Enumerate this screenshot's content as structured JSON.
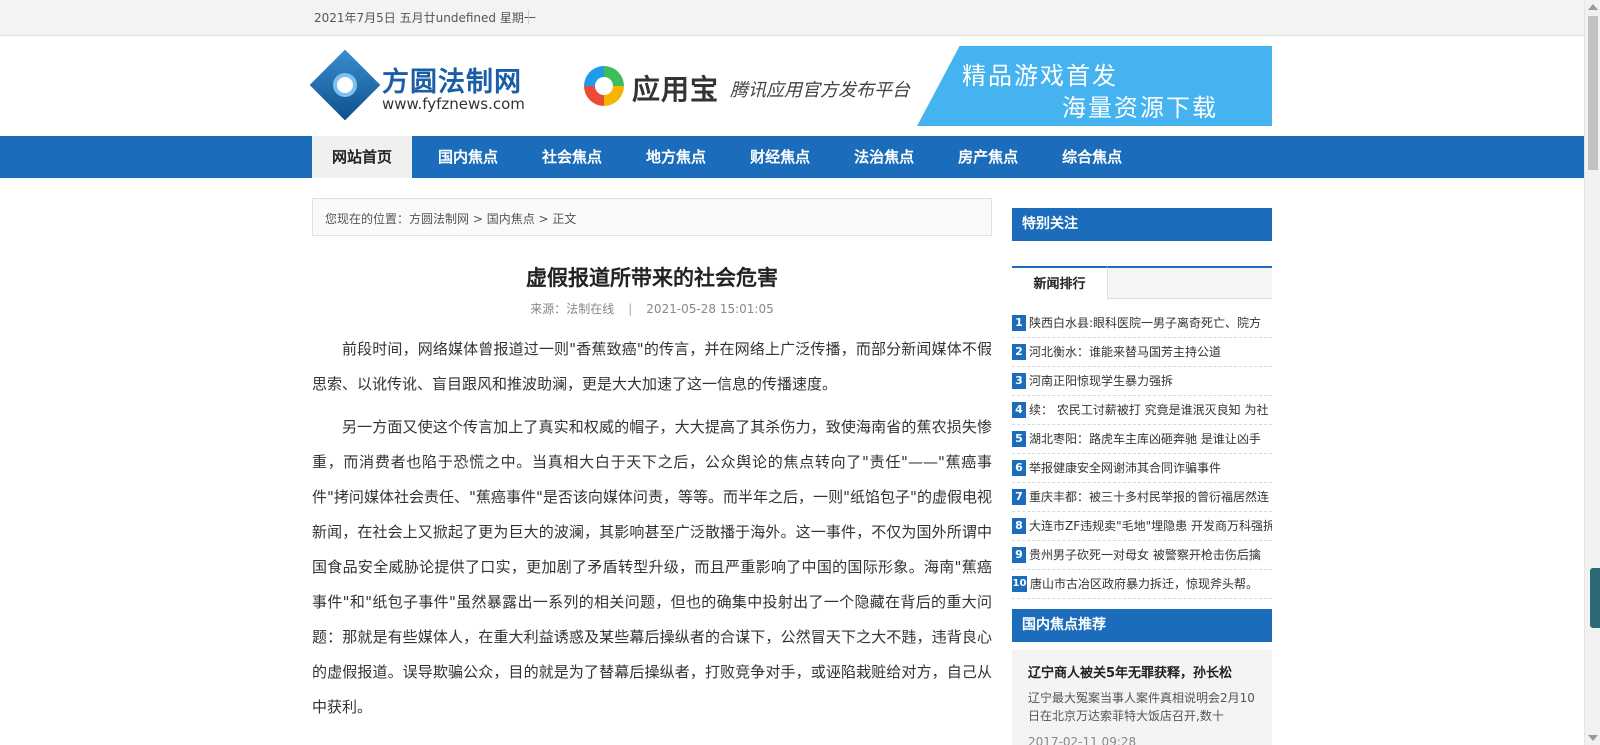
{
  "topbar": {
    "date": "2021年7月5日 五月廿undefined 星期一"
  },
  "logo": {
    "name_cn": "方圆法制网",
    "url_text": "www.fyfznews.com"
  },
  "banner": {
    "brand": "应用宝",
    "tagline": "腾讯应用官方发布平台",
    "slogan_line1": "精品游戏首发",
    "slogan_line2": "海量资源下载"
  },
  "nav": {
    "items": [
      {
        "label": "网站首页",
        "active": true
      },
      {
        "label": "国内焦点"
      },
      {
        "label": "社会焦点"
      },
      {
        "label": "地方焦点"
      },
      {
        "label": "财经焦点"
      },
      {
        "label": "法治焦点"
      },
      {
        "label": "房产焦点"
      },
      {
        "label": "综合焦点"
      }
    ]
  },
  "breadcrumb": {
    "prefix": "您现在的位置：",
    "home": "方圆法制网",
    "sep": " > ",
    "section": "国内焦点",
    "current": "正文"
  },
  "article": {
    "title": "虚假报道所带来的社会危害",
    "source": "来源：法制在线",
    "divider": "|",
    "datetime": "2021-05-28 15:01:05",
    "paragraphs": [
      "前段时间，网络媒体曾报道过一则\"香蕉致癌\"的传言，并在网络上广泛传播，而部分新闻媒体不假思索、以讹传讹、盲目跟风和推波助澜，更是大大加速了这一信息的传播速度。",
      "另一方面又使这个传言加上了真实和权威的帽子，大大提高了其杀伤力，致使海南省的蕉农损失惨重，而消费者也陷于恐慌之中。当真相大白于天下之后，公众舆论的焦点转向了\"责任\"——\"蕉癌事件\"拷问媒体社会责任、\"蕉癌事件\"是否该向媒体问责，等等。而半年之后，一则\"纸馅包子\"的虚假电视新闻，在社会上又掀起了更为巨大的波澜，其影响甚至广泛散播于海外。这一事件，不仅为国外所谓中国食品安全威胁论提供了口实，更加剧了矛盾转型升级，而且严重影响了中国的国际形象。海南\"蕉癌事件\"和\"纸包子事件\"虽然暴露出一系列的相关问题，但也的确集中投射出了一个隐藏在背后的重大问题：那就是有些媒体人，在重大利益诱惑及某些幕后操纵者的合谋下，公然冒天下之大不韪，违背良心的虚假报道。误导欺骗公众，目的就是为了替幕后操纵者，打败竞争对手，或诬陷栽赃给对方，自己从中获利。"
    ]
  },
  "sidebar": {
    "special_title": "特别关注",
    "rank_tab": "新闻排行",
    "rank_items": [
      {
        "num": "1",
        "text": "陕西白水县:眼科医院一男子离奇死亡、院方"
      },
      {
        "num": "2",
        "text": "河北衡水：谁能来替马国芳主持公道"
      },
      {
        "num": "3",
        "text": "河南正阳惊现学生暴力强拆"
      },
      {
        "num": "4",
        "text": "续： 农民工讨薪被打 究竟是谁泯灭良知 为社"
      },
      {
        "num": "5",
        "text": "湖北枣阳：路虎车主库凶砸奔驰 是谁让凶手"
      },
      {
        "num": "6",
        "text": "举报健康安全网谢沛其合同诈骗事件"
      },
      {
        "num": "7",
        "text": "重庆丰都：被三十多村民举报的曾衍福居然连"
      },
      {
        "num": "8",
        "text": "大连市ZF违规卖\"毛地\"埋隐患 开发商万科强拆"
      },
      {
        "num": "9",
        "text": "贵州男子砍死一对母女 被警察开枪击伤后擒"
      },
      {
        "num": "10",
        "text": "唐山市古冶区政府暴力拆迁，惊现斧头帮。"
      }
    ],
    "rec_title": "国内焦点推荐",
    "rec": {
      "headline": "辽宁商人被关5年无罪获释，孙长松",
      "summary": "辽宁最大冤案当事人案件真相说明会2月10日在北京万达索菲特大饭店召开,数十",
      "date": "2017-02-11 09:28"
    }
  },
  "colors": {
    "brand_blue": "#1b6dbb",
    "banner_blue": "#44b3ef"
  }
}
